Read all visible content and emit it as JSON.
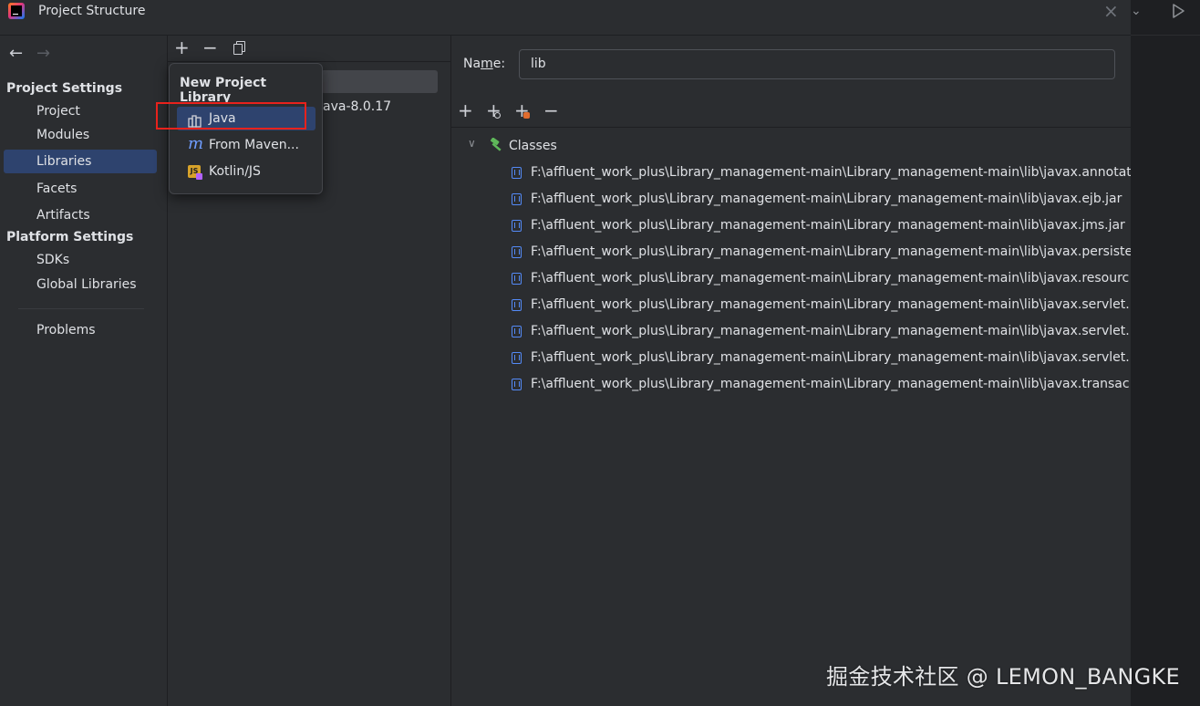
{
  "window": {
    "title": "Project Structure"
  },
  "left_nav": {
    "project_settings_header": "Project Settings",
    "project_settings_items": [
      {
        "label": "Project"
      },
      {
        "label": "Modules"
      },
      {
        "label": "Libraries",
        "selected": true
      },
      {
        "label": "Facets"
      },
      {
        "label": "Artifacts"
      }
    ],
    "platform_settings_header": "Platform Settings",
    "platform_settings_items": [
      {
        "label": "SDKs"
      },
      {
        "label": "Global Libraries"
      }
    ],
    "problems_label": "Problems"
  },
  "library_list": {
    "visible_item_text": "ava-8.0.17"
  },
  "popup": {
    "title": "New Project Library",
    "items": [
      {
        "label": "Java",
        "icon": "java-library-icon",
        "selected": true
      },
      {
        "label": "From Maven...",
        "icon": "maven-icon"
      },
      {
        "label": "Kotlin/JS",
        "icon": "kotlin-js-icon"
      }
    ]
  },
  "library_detail": {
    "name_label": "Name:",
    "name_value": "lib",
    "classes_node": "Classes",
    "class_paths": [
      "F:\\affluent_work_plus\\Library_management-main\\Library_management-main\\lib\\javax.annotat",
      "F:\\affluent_work_plus\\Library_management-main\\Library_management-main\\lib\\javax.ejb.jar",
      "F:\\affluent_work_plus\\Library_management-main\\Library_management-main\\lib\\javax.jms.jar",
      "F:\\affluent_work_plus\\Library_management-main\\Library_management-main\\lib\\javax.persiste",
      "F:\\affluent_work_plus\\Library_management-main\\Library_management-main\\lib\\javax.resourc",
      "F:\\affluent_work_plus\\Library_management-main\\Library_management-main\\lib\\javax.servlet.",
      "F:\\affluent_work_plus\\Library_management-main\\Library_management-main\\lib\\javax.servlet.",
      "F:\\affluent_work_plus\\Library_management-main\\Library_management-main\\lib\\javax.servlet.",
      "F:\\affluent_work_plus\\Library_management-main\\Library_management-main\\lib\\javax.transac"
    ]
  },
  "watermark": "掘金技术社区 @ LEMON_BANGKE",
  "colors": {
    "background": "#2b2d30",
    "selection": "#2e436e",
    "highlight_box": "#e8221c",
    "jar_icon": "#548af7",
    "hammer_icon": "#5fb85a"
  }
}
